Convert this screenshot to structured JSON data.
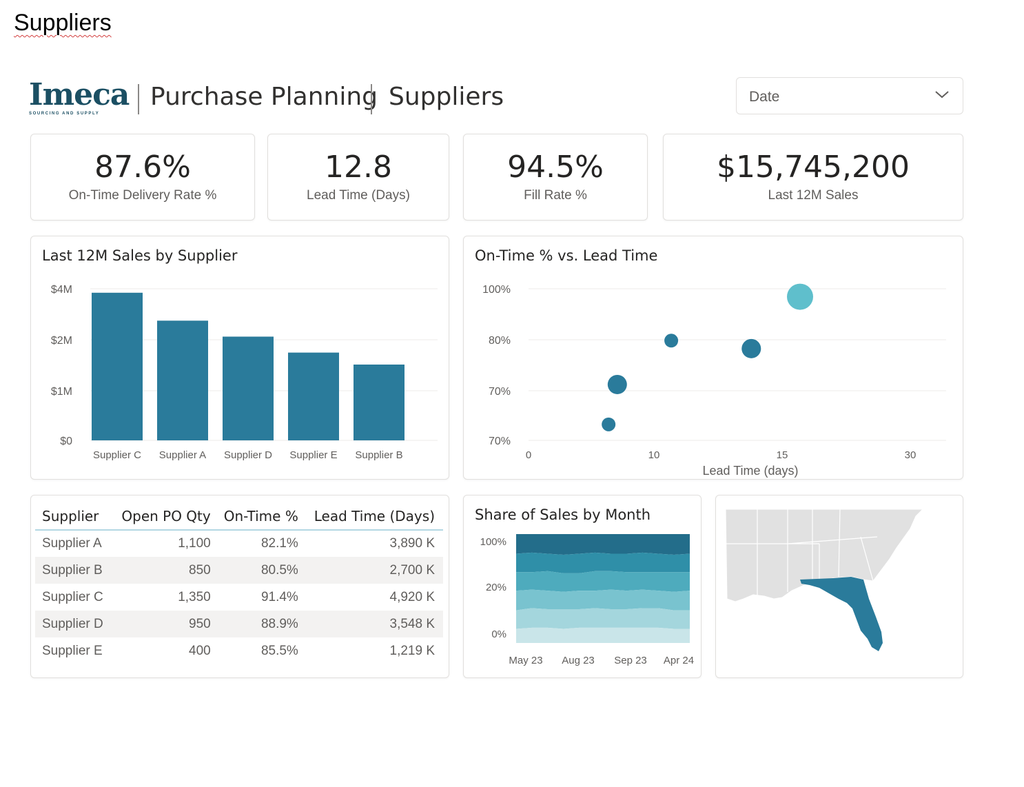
{
  "doc_title": "Suppliers",
  "header": {
    "logo_text": "Imeca",
    "logo_tagline": "SOURCING AND SUPPLY",
    "section": "Purchase Planning",
    "page": "Suppliers",
    "date_slicer_label": "Date"
  },
  "kpis": [
    {
      "value": "87.6%",
      "label": "On-Time Delivery Rate %"
    },
    {
      "value": "12.8",
      "label": "Lead Time (Days)"
    },
    {
      "value": "94.5%",
      "label": "Fill Rate %"
    },
    {
      "value": "$15,745,200",
      "label": "Last 12M Sales"
    }
  ],
  "bar_chart": {
    "title": "Last 12M Sales by Supplier"
  },
  "scatter_chart": {
    "title": "On-Time % vs. Lead Time"
  },
  "area_chart": {
    "title": "Share of Sales by Month"
  },
  "table": {
    "columns": [
      "Supplier",
      "Open PO Qty",
      "On-Time %",
      "Lead Time (Days)"
    ],
    "rows": [
      [
        "Supplier A",
        "1,100",
        "82.1%",
        "3,890 K"
      ],
      [
        "Supplier B",
        "850",
        "80.5%",
        "2,700 K"
      ],
      [
        "Supplier C",
        "1,350",
        "91.4%",
        "4,920 K"
      ],
      [
        "Supplier D",
        "950",
        "88.9%",
        "3,548 K"
      ],
      [
        "Supplier E",
        "400",
        "85.5%",
        "1,219 K"
      ]
    ]
  },
  "colors": {
    "bar": "#2a7b9b",
    "scatter": "#2a7b9b",
    "scatter_highlight": "#5fbfcc",
    "map_land": "#e1e1e1",
    "map_highlight": "#2a7b9b",
    "area_bands": [
      "#236d8a",
      "#2f8fa8",
      "#4eabbd",
      "#79c3cf",
      "#a4d6dd",
      "#c9e5e9"
    ]
  },
  "chart_data": [
    {
      "type": "bar",
      "title": "Last 12M Sales by Supplier",
      "categories": [
        "Supplier C",
        "Supplier A",
        "Supplier D",
        "Supplier E",
        "Supplier B"
      ],
      "values": [
        3.7,
        3.0,
        2.6,
        2.2,
        1.9
      ],
      "yticks": [
        "$0",
        "$1M",
        "$2M",
        "$4M"
      ],
      "legend": "none"
    },
    {
      "type": "scatter",
      "title": "On-Time % vs. Lead Time",
      "xlabel": "Lead Time (days)",
      "xticks": [
        "0",
        "10",
        "15",
        "30"
      ],
      "yticks": [
        "70%",
        "70%",
        "80%",
        "100%"
      ],
      "points": [
        {
          "x": 4.6,
          "y": 66,
          "size": "small"
        },
        {
          "x": 5.1,
          "y": 76,
          "size": "medium"
        },
        {
          "x": 8.2,
          "y": 87,
          "size": "small"
        },
        {
          "x": 12.8,
          "y": 85,
          "size": "medium"
        },
        {
          "x": 15.6,
          "y": 98,
          "size": "large",
          "highlight": true
        }
      ],
      "grid": true
    },
    {
      "type": "area",
      "title": "Share of Sales by Month",
      "stacked": "percent",
      "xticks": [
        "May 23",
        "Aug 23",
        "Sep 23",
        "Apr 24"
      ],
      "yticks": [
        "0%",
        "20%",
        "100%"
      ],
      "series": [
        {
          "values": [
            18,
            17,
            18,
            19,
            18,
            17,
            18,
            18,
            17,
            18,
            19,
            18
          ]
        },
        {
          "values": [
            17,
            18,
            16,
            17,
            18,
            17,
            16,
            17,
            18,
            17,
            16,
            17
          ]
        },
        {
          "values": [
            17,
            16,
            18,
            17,
            16,
            18,
            17,
            17,
            16,
            17,
            18,
            17
          ]
        },
        {
          "values": [
            18,
            17,
            17,
            16,
            17,
            16,
            18,
            17,
            17,
            16,
            17,
            18
          ]
        },
        {
          "values": [
            17,
            18,
            17,
            18,
            17,
            18,
            17,
            17,
            18,
            18,
            17,
            17
          ]
        },
        {
          "values": [
            13,
            14,
            14,
            13,
            14,
            14,
            14,
            14,
            14,
            14,
            13,
            13
          ]
        }
      ]
    }
  ]
}
